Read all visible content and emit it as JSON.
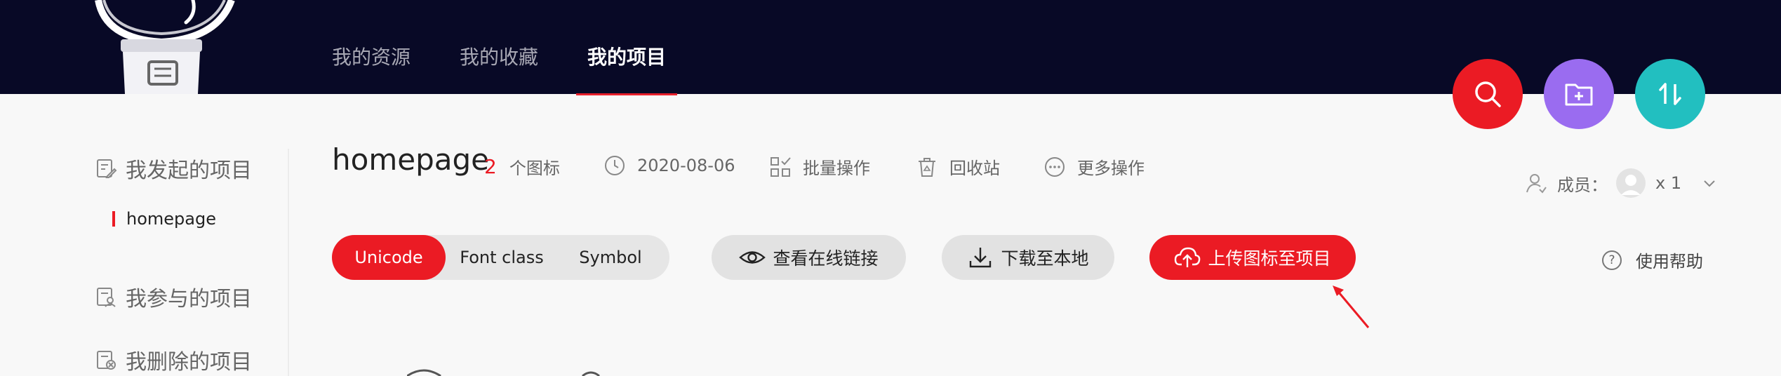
{
  "header": {
    "nav": [
      {
        "label": "我的资源",
        "active": false
      },
      {
        "label": "我的收藏",
        "active": false
      },
      {
        "label": "我的项目",
        "active": true
      }
    ],
    "action_buttons": [
      {
        "icon": "search-icon",
        "color": "#eb1b24"
      },
      {
        "icon": "add-folder-icon",
        "color": "#9a6cf0"
      },
      {
        "icon": "sort-icon",
        "color": "#22bfc0"
      }
    ]
  },
  "sidebar": {
    "created_label": "我发起的项目",
    "current_project": "homepage",
    "joined_label": "我参与的项目",
    "deleted_label": "我删除的项目"
  },
  "project": {
    "title": "homepage",
    "icon_count": "2",
    "icon_count_unit": "个图标",
    "date": "2020-08-06",
    "batch_label": "批量操作",
    "recycle_label": "回收站",
    "more_label": "更多操作",
    "members_label": "成员：",
    "members_count": "x 1"
  },
  "toolbar": {
    "format_tabs": [
      {
        "label": "Unicode",
        "active": true
      },
      {
        "label": "Font class",
        "active": false
      },
      {
        "label": "Symbol",
        "active": false
      }
    ],
    "view_link_label": "查看在线链接",
    "download_label": "下载至本地",
    "upload_label": "上传图标至项目",
    "help_label": "使用帮助",
    "help_icon_glyph": "?"
  },
  "colors": {
    "header_bg": "#080926",
    "accent_red": "#eb1b24",
    "purple": "#9a6cf0",
    "teal": "#22bfc0"
  }
}
